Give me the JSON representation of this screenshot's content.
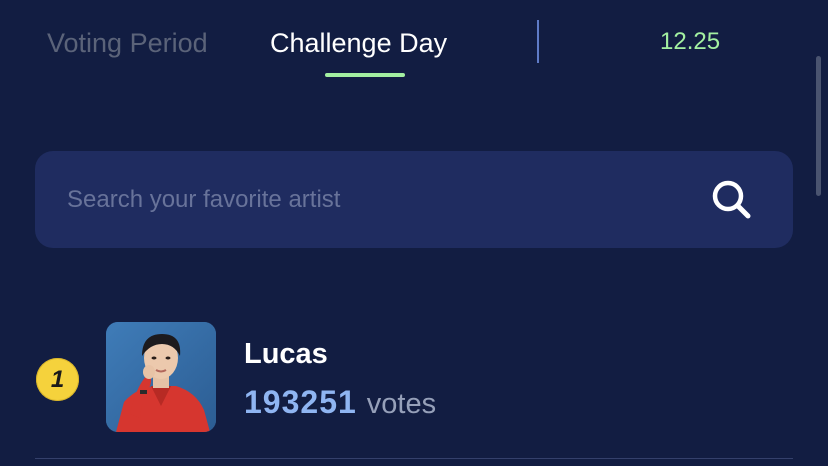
{
  "tabs": [
    {
      "label": "Voting Period",
      "active": false
    },
    {
      "label": "Challenge Day",
      "active": true
    }
  ],
  "date": "12.25",
  "colors": {
    "background": "#121d42",
    "accent": "#a3f0a1",
    "search_bg": "#1f2c60",
    "vote_count": "#8fb5f2",
    "rank_badge": "#f5d23c"
  },
  "search": {
    "placeholder": "Search your favorite artist",
    "value": "",
    "icon": "search-icon"
  },
  "ranking": [
    {
      "rank": "1",
      "name": "Lucas",
      "votes": "193251",
      "votes_unit": "votes",
      "avatar_icon": "artist-photo"
    }
  ]
}
